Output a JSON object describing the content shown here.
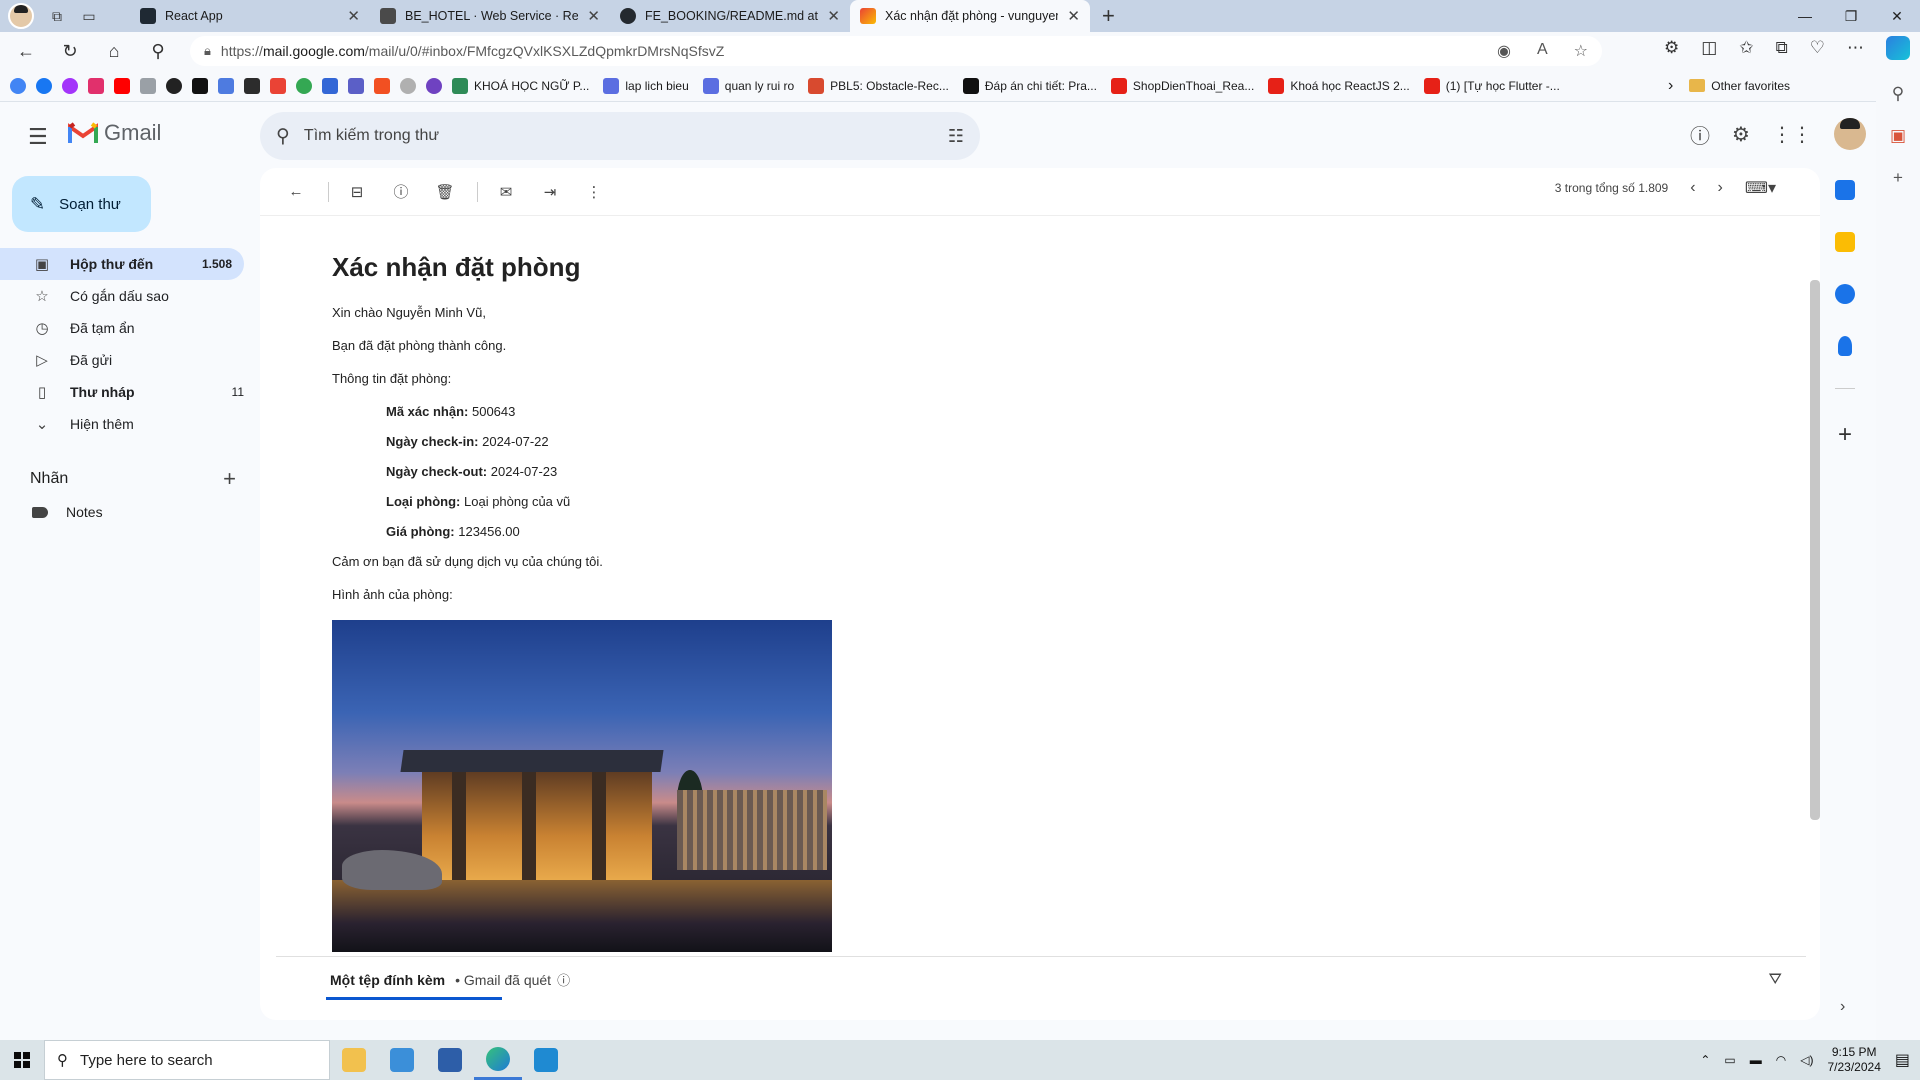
{
  "browser": {
    "tabs": [
      {
        "title": "React App",
        "color": "#1f2933",
        "active": false
      },
      {
        "title": "BE_HOTEL · Web Service · Render",
        "color": "#4a4a4a",
        "active": false
      },
      {
        "title": "FE_BOOKING/README.md at dev",
        "color": "#24292f",
        "active": false
      },
      {
        "title": "Xác nhận đặt phòng - vunguyen",
        "color": "#ea4335",
        "active": true
      }
    ],
    "url_prefix": "https://",
    "url_domain": "mail.google.com",
    "url_path": "/mail/u/0/#inbox/FMfcgzQVxlKSXLZdQpmkrDMrsNqSfsvZ",
    "favorites": [
      {
        "label": "KHOÁ HỌC NGỮ P...",
        "color": "#2e8b57"
      },
      {
        "label": "lap lich bieu",
        "color": "#5b6ee1"
      },
      {
        "label": "quan ly rui ro",
        "color": "#5b6ee1"
      },
      {
        "label": "PBL5: Obstacle-Rec...",
        "color": "#d84a2f"
      },
      {
        "label": "Đáp án chi tiết: Pra...",
        "color": "#111111"
      },
      {
        "label": "ShopDienThoai_Rea...",
        "color": "#e62117"
      },
      {
        "label": "Khoá học ReactJS 2...",
        "color": "#e62117"
      },
      {
        "label": "(1) [Tự học Flutter -...",
        "color": "#e62117"
      }
    ],
    "other_favorites": "Other favorites"
  },
  "gmail": {
    "logo_text": "Gmail",
    "search_placeholder": "Tìm kiếm trong thư",
    "compose_label": "Soạn thư",
    "nav": [
      {
        "label": "Hộp thư đến",
        "count": "1.508",
        "icon": "inbox-icon",
        "glyph": "▣"
      },
      {
        "label": "Có gắn dấu sao",
        "count": "",
        "icon": "star-icon",
        "glyph": "☆"
      },
      {
        "label": "Đã tạm ẩn",
        "count": "",
        "icon": "clock-icon",
        "glyph": "◷"
      },
      {
        "label": "Đã gửi",
        "count": "",
        "icon": "send-icon",
        "glyph": "▷"
      },
      {
        "label": "Thư nháp",
        "count": "11",
        "icon": "draft-icon",
        "glyph": "▯"
      },
      {
        "label": "Hiện thêm",
        "count": "",
        "icon": "chevron-down-icon",
        "glyph": "⌄"
      }
    ],
    "labels_heading": "Nhãn",
    "labels": [
      {
        "label": "Notes"
      }
    ],
    "pager_text": "3 trong tổng số 1.809"
  },
  "email": {
    "title": "Xác nhận đặt phòng",
    "greeting": "Xin chào Nguyễn Minh Vũ,",
    "success": "Bạn đã đặt phòng thành công.",
    "info_heading": "Thông tin đặt phòng:",
    "details": [
      {
        "label": "Mã xác nhận:",
        "value": "500643"
      },
      {
        "label": "Ngày check-in:",
        "value": "2024-07-22"
      },
      {
        "label": "Ngày check-out:",
        "value": "2024-07-23"
      },
      {
        "label": "Loại phòng:",
        "value": "Loại phòng của vũ"
      },
      {
        "label": "Giá phòng:",
        "value": "123456.00"
      }
    ],
    "thanks": "Cảm ơn bạn đã sử dụng dịch vụ của chúng tôi.",
    "image_heading": "Hình ảnh của phòng:",
    "attachments_title": "Một tệp đính kèm",
    "attachments_sub": "• Gmail đã quét"
  },
  "taskbar": {
    "search_placeholder": "Type here to search",
    "time": "9:15 PM",
    "date": "7/23/2024"
  }
}
